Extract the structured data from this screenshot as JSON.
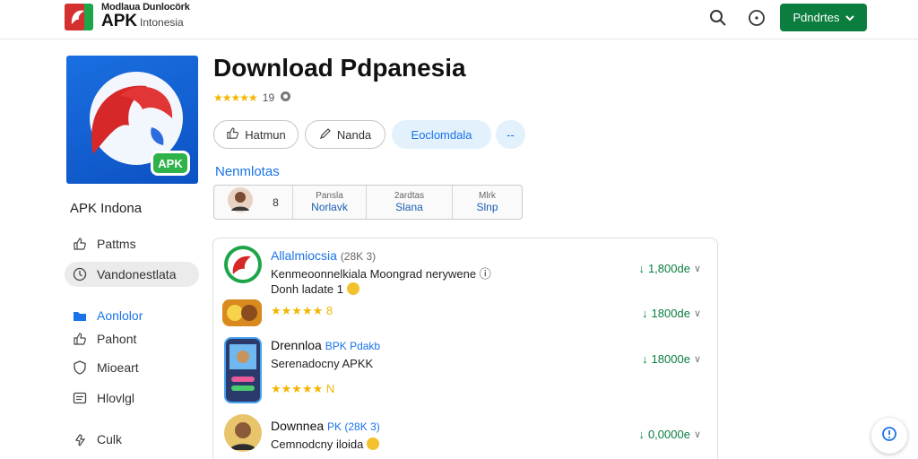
{
  "header": {
    "brand_top": "Modlaua Dunlocörk",
    "brand_main": "APK",
    "brand_sub": "Intonesia",
    "cta_label": "Pdndrtes"
  },
  "sidebar": {
    "app_badge": "APK",
    "title": "APK Indona",
    "items": [
      {
        "label": "Pattms",
        "icon": "thumbs-up-icon"
      },
      {
        "label": "Vandonestlata",
        "icon": "clock-icon"
      },
      {
        "label": "Aonlolor",
        "icon": "folder-icon"
      },
      {
        "label": "Pahont",
        "icon": "thumb-icon"
      },
      {
        "label": "Mioeart",
        "icon": "shield-icon"
      },
      {
        "label": "Hlovlgl",
        "icon": "list-icon"
      },
      {
        "label": "Culk",
        "icon": "pointer-icon"
      }
    ]
  },
  "main": {
    "title": "Download Pdpanesia",
    "stars": "★★★★★",
    "rating_value": "19",
    "actions": {
      "pill1": "Hatmun",
      "pill2": "Nanda",
      "pill3": "Eoclomdala",
      "pill4": "--"
    },
    "section_label": "Nenmlotas",
    "info": {
      "c1_small": "",
      "c1_val": "8",
      "c2_small": "Pansla",
      "c2_val": "Norlavk",
      "c3_small": "2ardtas",
      "c3_val": "Slana",
      "c4_small": "Mlrk",
      "c4_val": "Slnp"
    }
  },
  "list": [
    {
      "title_a": "Allalmiocsia",
      "title_b": "(28K 3)",
      "line2": "Kenmeoonnelkiala Moongrad nerywene",
      "line3": "Donh ladate 1",
      "dl": "1,800de"
    },
    {
      "title_a": "",
      "title_b": "",
      "line2": "",
      "line3": "★★★★★ 8",
      "dl": "1800de"
    },
    {
      "title_a": "Drennloa",
      "title_b": "BPK Pdakb",
      "line2": "Serenadocny APKK",
      "line3": "★★★★★ N",
      "dl": "18000e"
    },
    {
      "title_a": "Downnea",
      "title_b": "PK (28K 3)",
      "line2": "Cemnodcny iloida",
      "line3": "",
      "dl": "0,0000e"
    }
  ]
}
